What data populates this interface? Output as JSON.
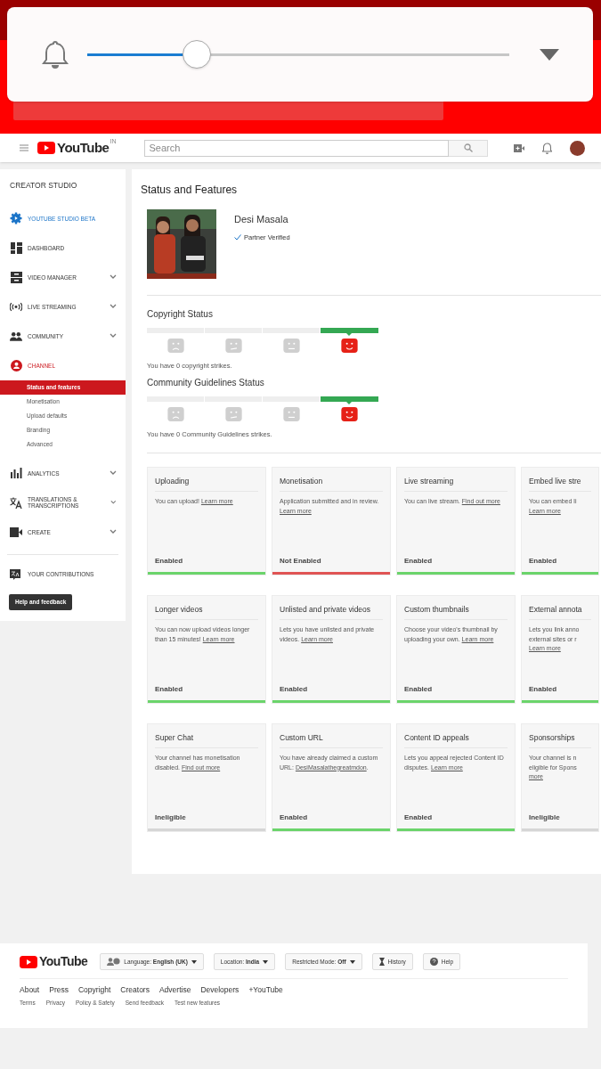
{
  "volume_overlay": {
    "level": 0.26
  },
  "header": {
    "logo": "YouTube",
    "region": "IN",
    "search": {
      "placeholder": "Search"
    }
  },
  "sidebar": {
    "title": "CREATOR STUDIO",
    "items": [
      {
        "kind": "studio",
        "label": "YOUTUBE STUDIO BETA",
        "expandable": false,
        "active": false
      },
      {
        "kind": "dashboard",
        "label": "DASHBOARD",
        "expandable": false,
        "active": false
      },
      {
        "kind": "video",
        "label": "VIDEO MANAGER",
        "expandable": true,
        "active": false
      },
      {
        "kind": "live",
        "label": "LIVE STREAMING",
        "expandable": true,
        "active": false
      },
      {
        "kind": "community",
        "label": "COMMUNITY",
        "expandable": true,
        "active": false
      },
      {
        "kind": "channel",
        "label": "CHANNEL",
        "expandable": false,
        "active": true,
        "children": [
          {
            "label": "Status and features",
            "selected": true
          },
          {
            "label": "Monetisation",
            "selected": false
          },
          {
            "label": "Upload defaults",
            "selected": false
          },
          {
            "label": "Branding",
            "selected": false
          },
          {
            "label": "Advanced",
            "selected": false
          }
        ]
      },
      {
        "kind": "analytics",
        "label": "ANALYTICS",
        "expandable": true,
        "active": false
      },
      {
        "kind": "translate",
        "label": "TRANSLATIONS & TRANSCRIPTIONS",
        "expandable": true,
        "active": false
      },
      {
        "kind": "create",
        "label": "CREATE",
        "expandable": true,
        "active": false
      }
    ],
    "contributions": "YOUR CONTRIBUTIONS",
    "help_button": "Help and feedback"
  },
  "main": {
    "title": "Status and Features",
    "channel": {
      "kind": "picture",
      "name": "Desi Masala",
      "badge": "Partner Verified"
    },
    "statuses": [
      {
        "title": "Copyright Status",
        "segments": [
          {
            "selected": false
          },
          {
            "selected": false
          },
          {
            "selected": false
          },
          {
            "selected": true
          }
        ],
        "message": "You have 0 copyright strikes."
      },
      {
        "title": "Community Guidelines Status",
        "segments": [
          {
            "selected": false
          },
          {
            "selected": false
          },
          {
            "selected": false
          },
          {
            "selected": true
          }
        ],
        "message": "You have 0 Community Guidelines strikes."
      }
    ],
    "features": [
      {
        "title": "Uploading",
        "text": "You can upload!",
        "link": "Learn more",
        "status": "Enabled",
        "kind": "enabled"
      },
      {
        "title": "Monetisation",
        "text": "Application submitted and in review.",
        "link": "Learn more",
        "status": "Not Enabled",
        "kind": "disabled"
      },
      {
        "title": "Live streaming",
        "text": "You can live stream.",
        "link": "Find out more",
        "status": "Enabled",
        "kind": "enabled"
      },
      {
        "title": "Embed live stre",
        "text": "You can embed li\n",
        "link": "Learn more",
        "status": "Enabled",
        "kind": "enabled"
      },
      {
        "title": "Longer videos",
        "text": "You can now upload videos longer than 15 minutes!",
        "link": "Learn more",
        "status": "Enabled",
        "kind": "enabled"
      },
      {
        "title": "Unlisted and private videos",
        "text": "Lets you have unlisted and private videos.",
        "link": "Learn more",
        "status": "Enabled",
        "kind": "enabled"
      },
      {
        "title": "Custom thumbnails",
        "text": "Choose your video's thumbnail by uploading your own.",
        "link": "Learn more",
        "status": "Enabled",
        "kind": "enabled"
      },
      {
        "title": "External annota",
        "text": "Lets you link anno\nexternal sites or r\n",
        "link": "Learn more",
        "status": "Enabled",
        "kind": "enabled"
      },
      {
        "title": "Super Chat",
        "text": "Your channel has monetisation disabled.",
        "link": "Find out more",
        "status": "Ineligible",
        "kind": "ineligible"
      },
      {
        "title": "Custom URL",
        "text": "You have already claimed a custom URL:",
        "link": "DesiMasalathegreatmdon",
        "after": ".",
        "status": "Enabled",
        "kind": "enabled"
      },
      {
        "title": "Content ID appeals",
        "text": "Lets you appeal rejected Content ID disputes.",
        "link": "Learn more",
        "status": "Enabled",
        "kind": "enabled"
      },
      {
        "title": "Sponsorships",
        "text": "Your channel is n\neligible for Spons\n",
        "link": "more",
        "status": "Ineligible",
        "kind": "ineligible"
      }
    ]
  },
  "footer": {
    "logo": "YouTube",
    "buttons": [
      {
        "kind": "language",
        "label": "Language:",
        "value": "English (UK)",
        "dropdown": true
      },
      {
        "kind": "plain",
        "label": "Location:",
        "value": "India",
        "dropdown": true
      },
      {
        "kind": "plain",
        "label": "Restricted Mode:",
        "value": "Off",
        "dropdown": true
      },
      {
        "kind": "history",
        "label": "History",
        "dropdown": false
      },
      {
        "kind": "help",
        "label": "Help",
        "dropdown": false
      }
    ],
    "links": [
      "About",
      "Press",
      "Copyright",
      "Creators",
      "Advertise",
      "Developers",
      "+YouTube"
    ],
    "small_links": [
      "Terms",
      "Privacy",
      "Policy & Safety",
      "Send feedback",
      "Test new features"
    ]
  }
}
